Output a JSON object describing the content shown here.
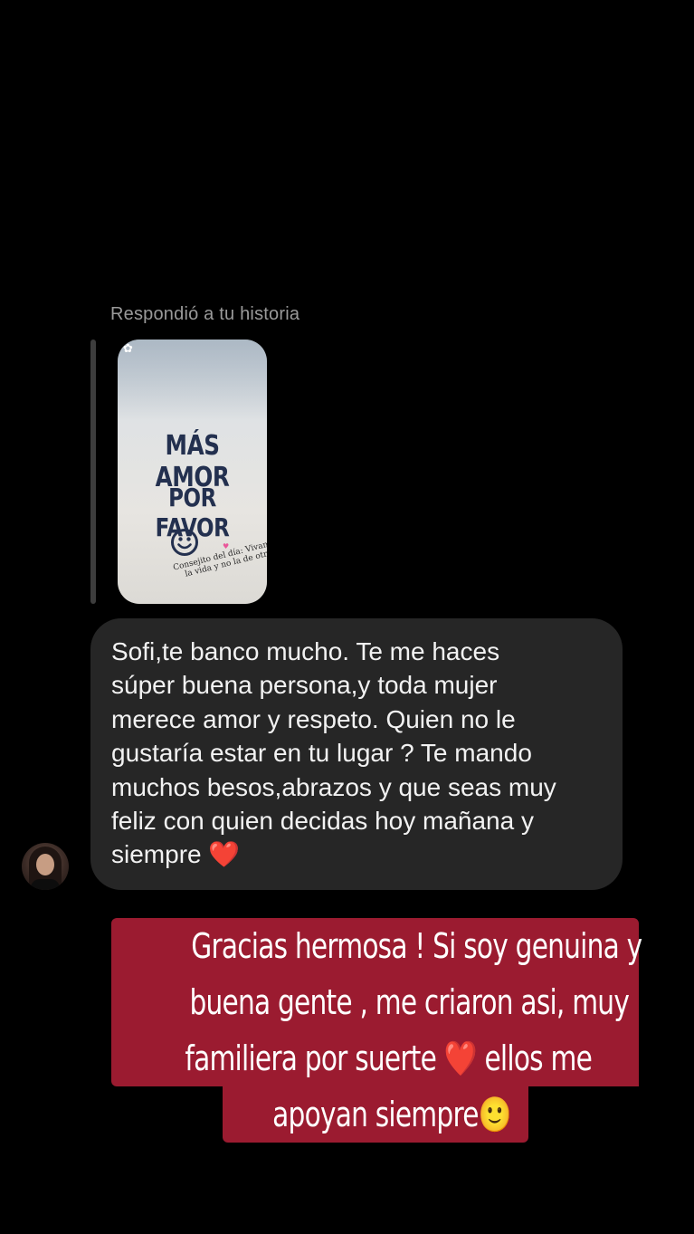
{
  "story_reply": {
    "label": "Respondió a tu historia",
    "story": {
      "line1": "MÁS AMOR",
      "line2": "POR FAVOR",
      "caption": "Consejito del día: Vivan más la vida y no la de otros!"
    }
  },
  "incoming_message": {
    "text": "Sofi,te banco mucho. Te me haces\nsúper buena persona,y toda mujer\nmerece amor y respeto. Quien no le\ngustaría estar en tu lugar ? Te mando\nmuchos besos,abrazos y que seas muy\nfeliz con quien decidas hoy mañana y\nsiempre ❤️"
  },
  "story_text_overlay": {
    "line1": "Gracias hermosa ! Si soy genuina y",
    "line2": "buena gente , me criaron asi, muy",
    "line3": "familiera por suerte ❤️ ellos me",
    "line4": "apoyan siempre🙂"
  },
  "colors": {
    "background": "#000000",
    "incoming_bubble": "#262626",
    "overlay_highlight": "#9b1b30",
    "label_gray": "#9a9a9a"
  }
}
